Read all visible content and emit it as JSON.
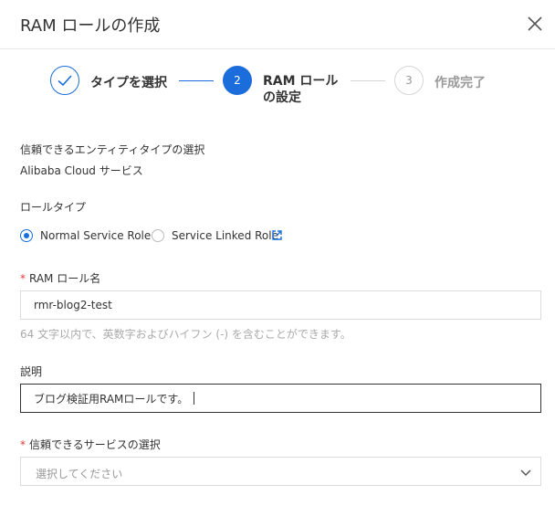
{
  "header": {
    "title": "RAM ロールの作成",
    "close_icon": "close-icon"
  },
  "steps": {
    "step1": {
      "label": "タイプを選択",
      "state": "done"
    },
    "step2": {
      "number": "2",
      "label_line1": "RAM ロール",
      "label_line2": "の設定",
      "state": "active"
    },
    "step3": {
      "number": "3",
      "label": "作成完了",
      "state": "pending"
    }
  },
  "entity": {
    "label": "信頼できるエンティティタイプの選択",
    "value": "Alibaba Cloud サービス"
  },
  "role_type": {
    "label": "ロールタイプ",
    "options": [
      {
        "label": "Normal Service Role",
        "selected": true
      },
      {
        "label": "Service Linked Role",
        "selected": false
      }
    ]
  },
  "role_name": {
    "required_mark": "*",
    "label": "RAM ロール名",
    "value": "rmr-blog2-test",
    "hint": "64 文字以内で、英数字およびハイフン (-) を含むことができます。"
  },
  "description": {
    "label": "説明",
    "value": "ブログ検証用RAMロールです。"
  },
  "trusted_service": {
    "required_mark": "*",
    "label": "信頼できるサービスの選択",
    "placeholder": "選択してください"
  },
  "colors": {
    "accent": "#1a6ddb",
    "required": "#e4393c",
    "border": "#dcdcdc"
  }
}
